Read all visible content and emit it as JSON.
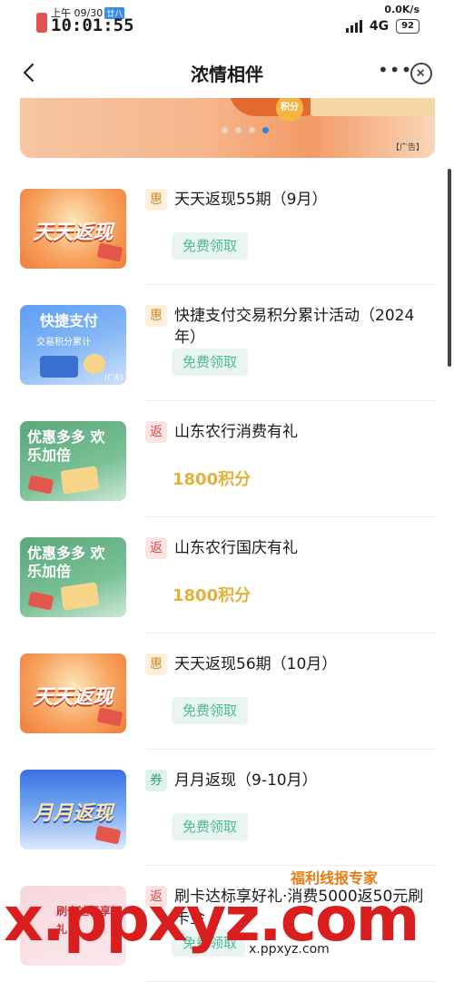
{
  "status_bar": {
    "date_prefix": "上午 09/30",
    "lunar_badge": "廿八",
    "time": "10:01:55",
    "net_speed": "0.0K/s",
    "network": "4G",
    "battery": "92"
  },
  "nav": {
    "title": "浓情相伴"
  },
  "banner": {
    "coin_label": "积分",
    "ad_label": "【广告】",
    "active_slide": 4,
    "total_slides": 4
  },
  "items": [
    {
      "thumb_text": "天天返现",
      "tag": "惠",
      "title": "天天返现55期（9月）",
      "action": "免费领取"
    },
    {
      "thumb_text": "快捷支付",
      "thumb_sub": "交易积分累计",
      "thumb_ad": "[广告]",
      "tag": "惠",
      "title": "快捷支付交易积分累计活动（2024年）",
      "action": "免费领取"
    },
    {
      "thumb_text": "优惠多多 欢乐加倍",
      "tag": "返",
      "title": "山东农行消费有礼",
      "points": "1800积分"
    },
    {
      "thumb_text": "优惠多多 欢乐加倍",
      "tag": "返",
      "title": "山东农行国庆有礼",
      "points": "1800积分"
    },
    {
      "thumb_text": "天天返现",
      "tag": "惠",
      "title": "天天返现56期（10月）",
      "action": "免费领取"
    },
    {
      "thumb_text": "月月返现",
      "tag": "券",
      "title": "月月返现（9-10月）",
      "action": "免费领取"
    },
    {
      "thumb_text": "刷卡达标享好礼",
      "tag": "返",
      "title": "刷卡达标享好礼·消费5000返50元刷卡金",
      "action": "免费领取"
    }
  ],
  "watermark": {
    "big": "x.ppxyz.com",
    "small": "x.ppxyz.com",
    "brand": "福利线报专家"
  }
}
